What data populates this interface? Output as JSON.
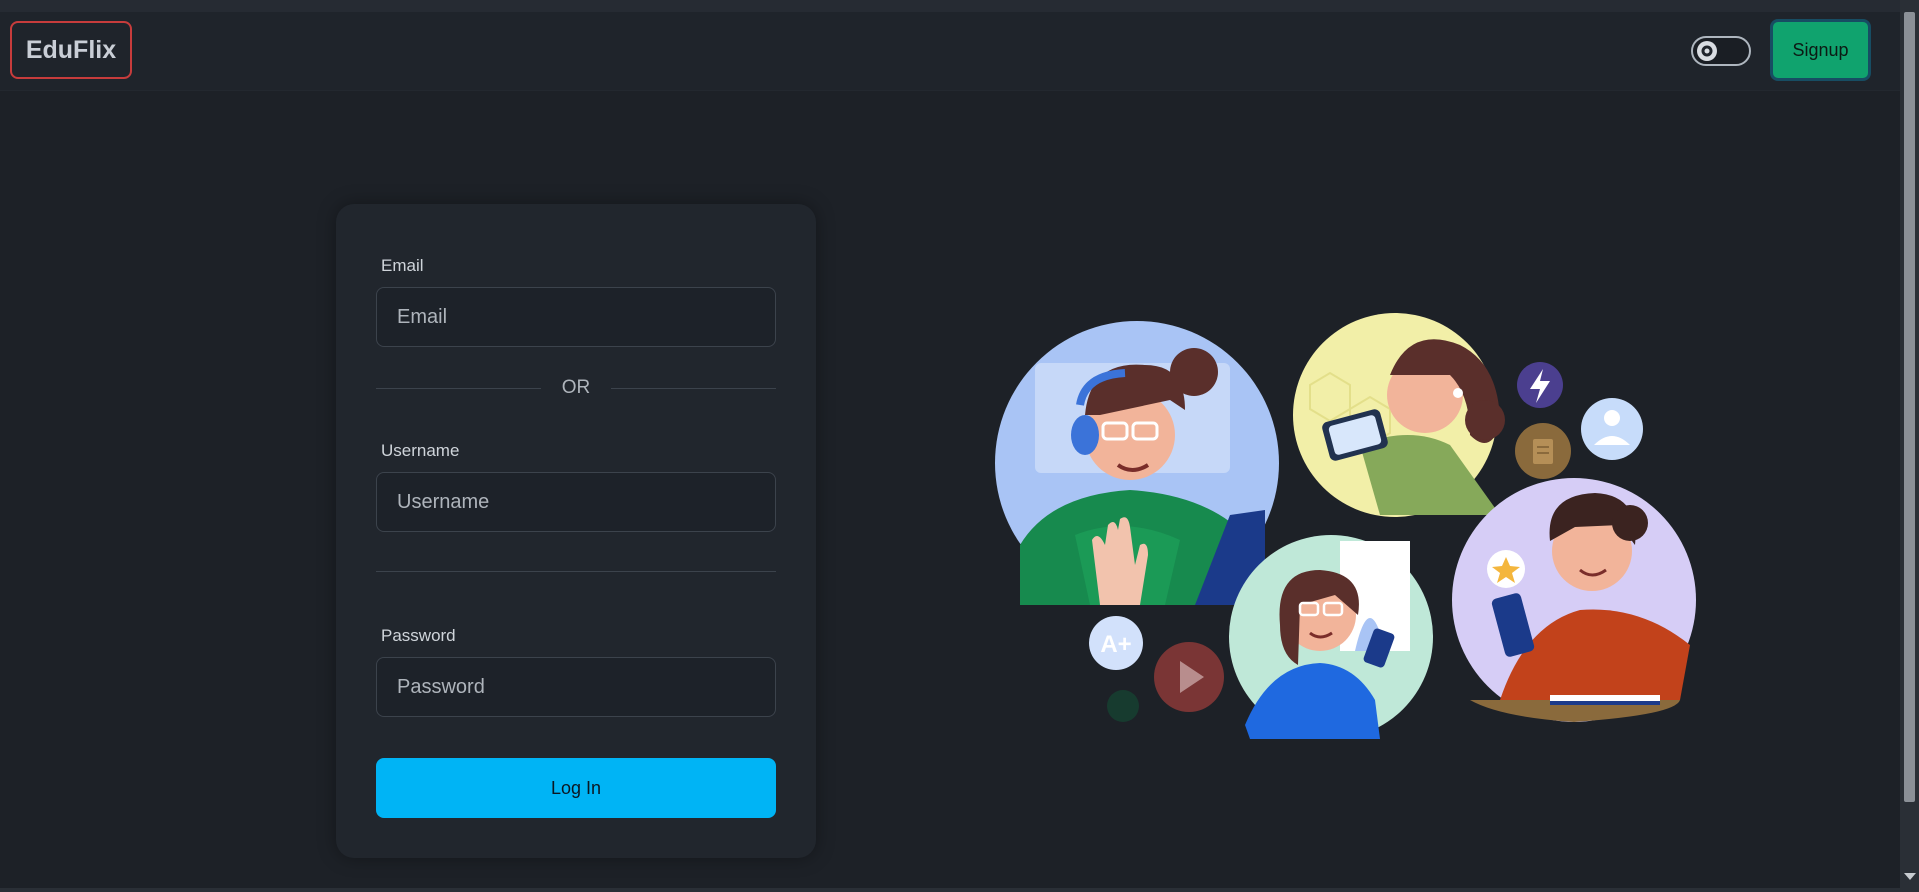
{
  "navbar": {
    "brand": "EduFlix",
    "theme_toggle_icon": "gear-icon",
    "signup_label": "Signup"
  },
  "login_form": {
    "email_label": "Email",
    "email_placeholder": "Email",
    "or_text": "OR",
    "username_label": "Username",
    "username_placeholder": "Username",
    "password_label": "Password",
    "password_placeholder": "Password",
    "submit_label": "Log In"
  },
  "colors": {
    "background": "#1d2127",
    "card": "#21262d",
    "brand_border": "#c73c3c",
    "signup_button": "#10a36e",
    "login_button": "#00b4f5"
  },
  "illustration": {
    "badge_text": "A+",
    "icons": [
      "lightning-icon",
      "user-icon",
      "document-icon",
      "play-icon",
      "star-icon"
    ]
  }
}
